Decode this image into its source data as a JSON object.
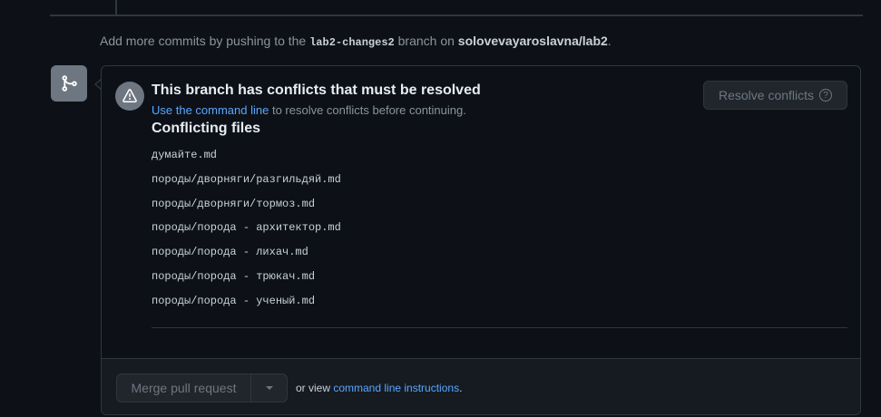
{
  "hint": {
    "prefix": "Add more commits by pushing to the ",
    "branch": "lab2-changes2",
    "middle": " branch on ",
    "repo": "solovevayaroslavna/lab2",
    "suffix": "."
  },
  "icons": {
    "merge": "git-merge-icon",
    "alert": "alert-triangle-icon",
    "help": "question-icon",
    "dropdown": "triangle-down-icon"
  },
  "conflict": {
    "title": "This branch has conflicts that must be resolved",
    "link_text": "Use the command line",
    "sub_text": " to resolve conflicts before continuing.",
    "resolve_button": "Resolve conflicts",
    "help_glyph": "?"
  },
  "files": {
    "heading": "Conflicting files",
    "items": [
      "думайте.md",
      "породы/дворняги/разгильдяй.md",
      "породы/дворняги/тормоз.md",
      "породы/порода - архитектор.md",
      "породы/порода - лихач.md",
      "породы/порода - трюкач.md",
      "породы/порода - ученый.md"
    ]
  },
  "footer": {
    "merge_button": "Merge pull request",
    "or_view": "or view ",
    "link_text": "command line instructions",
    "suffix": "."
  },
  "colors": {
    "background": "#0d1117",
    "link": "#58a6ff",
    "border": "#30363d",
    "icon_bg": "#6e7681"
  }
}
